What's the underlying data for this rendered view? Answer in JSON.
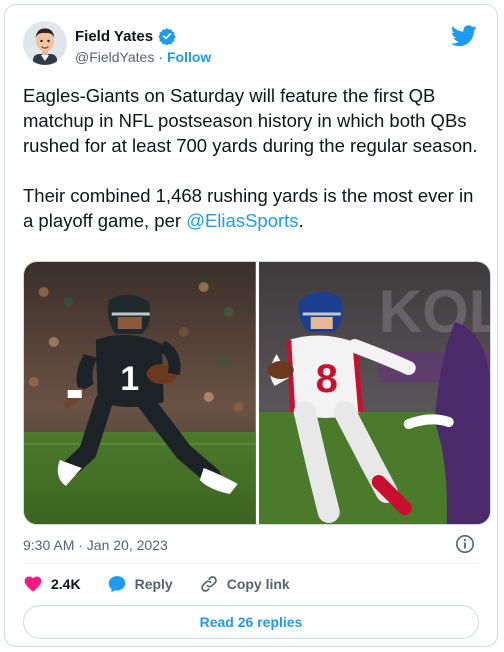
{
  "author": {
    "name": "Field Yates",
    "handle": "@FieldYates",
    "separator": "·",
    "follow_label": "Follow"
  },
  "tweet": {
    "paragraph1": "Eagles-Giants on Saturday will feature the first QB matchup in NFL postseason history in which both QBs rushed for at least 700 yards during the regular season.",
    "paragraph2_prefix": "Their combined 1,468 rushing yards is the most ever in a playoff game, per ",
    "mention": "@EliasSports",
    "paragraph2_suffix": "."
  },
  "media": {
    "left_jersey_number": "1",
    "right_jersey_number": "8"
  },
  "timestamp": "9:30 AM · Jan 20, 2023",
  "actions": {
    "likes": "2.4K",
    "reply_label": "Reply",
    "copy_label": "Copy link"
  },
  "read_replies_label": "Read 26 replies",
  "colors": {
    "accent": "#1d9bf0",
    "like": "#f91880",
    "text": "#0f1419",
    "muted": "#536471"
  },
  "icons": [
    "verified-badge-icon",
    "twitter-bird-icon",
    "info-icon",
    "heart-icon",
    "reply-bubble-icon",
    "link-icon"
  ]
}
